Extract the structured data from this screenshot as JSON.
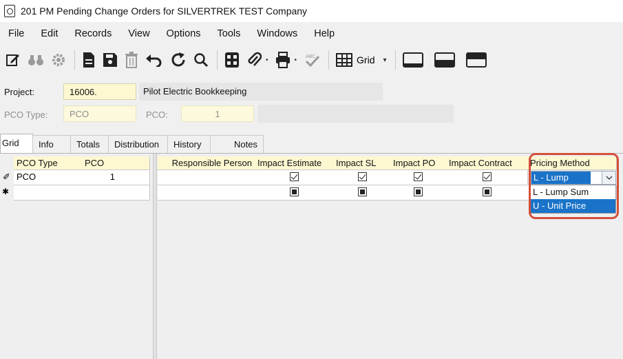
{
  "window": {
    "title": "201 PM Pending Change Orders for SILVERTREK TEST Company"
  },
  "menu": [
    "File",
    "Edit",
    "Records",
    "View",
    "Options",
    "Tools",
    "Windows",
    "Help"
  ],
  "toolbar": {
    "grid_label": "Grid",
    "icons": [
      "edit-icon",
      "binoculars-icon",
      "settings-icon",
      "new-record-icon",
      "save-icon",
      "delete-icon",
      "undo-icon",
      "refresh-icon",
      "search-icon",
      "calculator-icon",
      "attachment-icon",
      "print-icon",
      "spellcheck-icon",
      "grid-icon",
      "layout-bottom-icon",
      "layout-split-icon",
      "layout-top-icon"
    ]
  },
  "form": {
    "project_label": "Project:",
    "project_value": "16006.",
    "project_desc": "Pilot Electric Bookkeeping",
    "pco_type_label": "PCO Type:",
    "pco_type_value": "PCO",
    "pco_label": "PCO:",
    "pco_value": "1",
    "pco_desc": ""
  },
  "tabs": [
    "Grid",
    "Info",
    "Totals",
    "Distribution",
    "History",
    "Notes"
  ],
  "grid": {
    "left_columns": [
      "PCO Type",
      "PCO"
    ],
    "right_columns": [
      "Responsible Person",
      "Impact Estimate",
      "Impact SL",
      "Impact PO",
      "Impact Contract",
      "Pricing Method"
    ],
    "row1": {
      "pco_type": "PCO",
      "pco": "1",
      "responsible_person": "",
      "pricing_method": "L - Lump Sum"
    },
    "row_markers": [
      "✐",
      "✱"
    ]
  },
  "dropdown": {
    "options": [
      "L - Lump Sum",
      "U - Unit Price"
    ],
    "highlighted": "U - Unit Price"
  },
  "colors": {
    "accent": "#1a73c8",
    "highlight_border": "#d3503a",
    "input_bg": "#fdf8d1"
  }
}
